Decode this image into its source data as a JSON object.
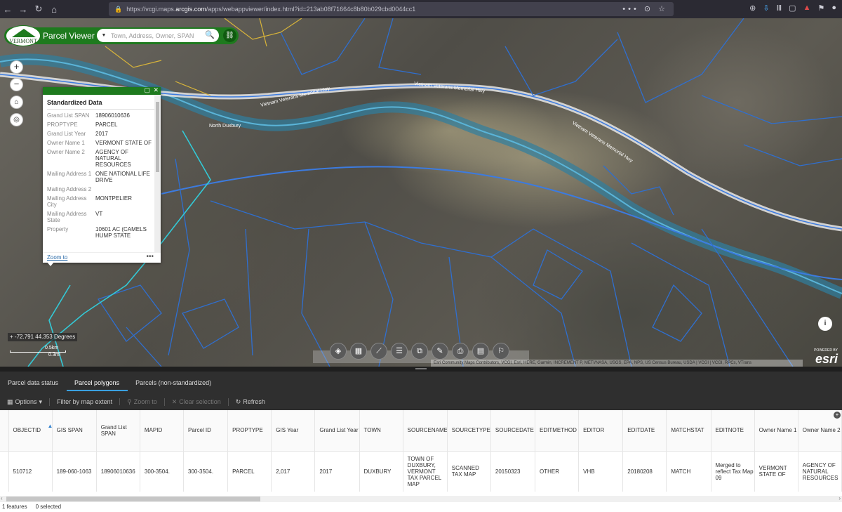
{
  "browser": {
    "url_prefix": "https://vcgi.maps.",
    "url_host": "arcgis.com",
    "url_path": "/apps/webappviewer/index.html?id=213ab08f71664c8b80b029cbd0044cc1",
    "url_tail": "••• ⊙ ☆"
  },
  "app": {
    "logo_text": "VERMONT",
    "title": "Parcel Viewer",
    "search_placeholder": "Town, Address, Owner, SPAN"
  },
  "map_labels": {
    "highway_1": "Vietnam Veterans Memorial Hwy",
    "highway_2": "Vietnam Veterans Memorial Hwy",
    "highway_3": "Vietnam Veterans Memorial Hwy",
    "place": "North Duxbury"
  },
  "popup": {
    "title": "Standardized Data",
    "rows": [
      {
        "k": "Grand List SPAN",
        "v": "18906010636"
      },
      {
        "k": "PROPTYPE",
        "v": "PARCEL"
      },
      {
        "k": "Grand List Year",
        "v": "2017"
      },
      {
        "k": "Owner Name 1",
        "v": "VERMONT STATE OF"
      },
      {
        "k": "Owner Name 2",
        "v": "AGENCY OF NATURAL RESOURCES"
      },
      {
        "k": "Mailing Address 1",
        "v": "ONE NATIONAL LIFE DRIVE"
      },
      {
        "k": "Mailing Address 2",
        "v": ""
      },
      {
        "k": "Mailing Address City",
        "v": "MONTPELIER"
      },
      {
        "k": "Mailing Address State",
        "v": "VT"
      },
      {
        "k": "Property",
        "v": "10601 AC (CAMELS HUMP STATE"
      }
    ],
    "zoom_to": "Zoom to",
    "more": "•••"
  },
  "coords": "-72.791 44.353 Degrees",
  "scale": {
    "top": "0.5km",
    "bottom": "0.3mi"
  },
  "attribution": "Esri Community Maps Contributors, VCGI, Esri, HERE, Garmin, INCREMENT P, METI/NASA, USGS, EPA, NPS, US Census Bureau, USDA | VCGI | VCGI, RPCs, VTrans",
  "powered": {
    "small": "POWERED BY",
    "big": "esri"
  },
  "panel": {
    "tabs": [
      "Parcel data status",
      "Parcel polygons",
      "Parcels (non-standardized)"
    ],
    "actions": {
      "options": "Options",
      "filter": "Filter by map extent",
      "zoom": "Zoom to",
      "clear": "Clear selection",
      "refresh": "Refresh"
    },
    "columns": [
      "OBJECTID",
      "GIS SPAN",
      "Grand List SPAN",
      "MAPID",
      "Parcel ID",
      "PROPTYPE",
      "GIS Year",
      "Grand List Year",
      "TOWN",
      "SOURCENAME",
      "SOURCETYPE",
      "SOURCEDATE",
      "EDITMETHOD",
      "EDITOR",
      "EDITDATE",
      "MATCHSTAT",
      "EDITNOTE",
      "Owner Name 1",
      "Owner Name 2"
    ],
    "row": [
      "510712",
      "189-060-1063",
      "18906010636",
      "300-3504.",
      "300-3504.",
      "PARCEL",
      "2,017",
      "2017",
      "DUXBURY",
      "TOWN OF DUXBURY, VERMONT TAX PARCEL MAP",
      "SCANNED TAX MAP",
      "20150323",
      "OTHER",
      "VHB",
      "20180208",
      "MATCH",
      "Merged to reflect Tax Map 09",
      "VERMONT STATE OF",
      "AGENCY OF NATURAL RESOURCES"
    ],
    "footer": {
      "features": "1 features",
      "selected": "0 selected"
    }
  },
  "colors": {
    "brand_green": "#1e7a1e",
    "parcel_blue": "#2f6fd0",
    "highlight_cyan": "#33c9d6",
    "tab_accent": "#3aa0e0"
  }
}
